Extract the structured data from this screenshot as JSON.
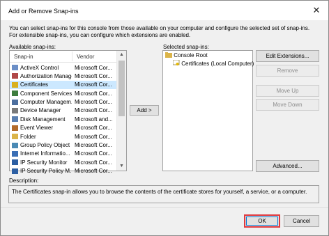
{
  "window": {
    "title": "Add or Remove Snap-ins"
  },
  "intro_text": "You can select snap-ins for this console from those available on your computer and configure the selected set of snap-ins. For extensible snap-ins, you can configure which extensions are enabled.",
  "available": {
    "label": "Available snap-ins:",
    "columns": {
      "snapin": "Snap-in",
      "vendor": "Vendor"
    },
    "items": [
      {
        "name": "ActiveX Control",
        "vendor": "Microsoft Cor...",
        "icon": "activex-icon"
      },
      {
        "name": "Authorization Manager",
        "vendor": "Microsoft Cor...",
        "icon": "authorization-icon"
      },
      {
        "name": "Certificates",
        "vendor": "Microsoft Cor...",
        "icon": "certificate-icon",
        "selected": true
      },
      {
        "name": "Component Services",
        "vendor": "Microsoft Cor...",
        "icon": "component-icon"
      },
      {
        "name": "Computer Managem...",
        "vendor": "Microsoft Cor...",
        "icon": "computer-icon"
      },
      {
        "name": "Device Manager",
        "vendor": "Microsoft Cor...",
        "icon": "device-icon"
      },
      {
        "name": "Disk Management",
        "vendor": "Microsoft and...",
        "icon": "disk-icon"
      },
      {
        "name": "Event Viewer",
        "vendor": "Microsoft Cor...",
        "icon": "event-icon"
      },
      {
        "name": "Folder",
        "vendor": "Microsoft Cor...",
        "icon": "folder-icon"
      },
      {
        "name": "Group Policy Object ...",
        "vendor": "Microsoft Cor...",
        "icon": "policy-icon"
      },
      {
        "name": "Internet Informatio...",
        "vendor": "Microsoft Cor...",
        "icon": "internet-icon"
      },
      {
        "name": "IP Security Monitor",
        "vendor": "Microsoft Cor...",
        "icon": "ipsec-icon"
      },
      {
        "name": "IP Security Policy M...",
        "vendor": "Microsoft Cor...",
        "icon": "ipsec-policy-icon"
      }
    ]
  },
  "add_button": "Add >",
  "selected": {
    "label": "Selected snap-ins:",
    "root": "Console Root",
    "child": "Certificates (Local Computer)"
  },
  "side_buttons": {
    "edit_extensions": "Edit Extensions...",
    "remove": "Remove",
    "move_up": "Move Up",
    "move_down": "Move Down",
    "advanced": "Advanced..."
  },
  "description": {
    "label": "Description:",
    "text": "The Certificates snap-in allows you to browse the contents of the certificate stores for yourself, a service, or a computer."
  },
  "footer": {
    "ok": "OK",
    "cancel": "Cancel"
  },
  "colors": {
    "selection": "#cce8ff",
    "highlight_border": "#e0393e",
    "focus_border": "#0078d7"
  }
}
